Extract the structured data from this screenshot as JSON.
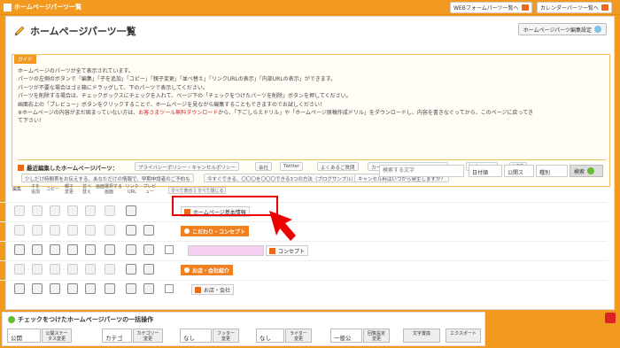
{
  "topbar": {
    "app_title": "ホームページパーツ一覧",
    "btn_web": "WEBフォームパーツ一覧へ",
    "btn_cal": "カレンダーパーツ一覧へ"
  },
  "page": {
    "title": "ホームページパーツ一覧",
    "settings_btn": "ホームページパーツ編集設定"
  },
  "guide": {
    "tag": "ガイド",
    "l1": "ホームページのパーツが全て表示されています。",
    "l2": "パーツの左側のボタンで「編集」「子を追加」「コピー」「親子変更」「並べ替え」「リンクURLの表示」「内部URLの表示」ができます。",
    "l3": "パーツが不要な場合はゴミ箱にドラッグして、下のパーツで表示してください。",
    "l4": "パーツを削除する場合は、チェックボックスにチェックを入れて、ページ下の「チェックをつけたパーツを削除」ボタンを押してください。",
    "l5": "画面右上の「プレビュー」ボタンをクリックすることで、ホームページを見ながら編集することもできますのでお試しください！",
    "l6a": "※ホームページの内容がまだ固まっていない方は、",
    "l6b": "お客さまツール無料ダウンロード",
    "l6c": "から、「下ごしらえドリル」や「ホームページ原稿作成ドリル」をダウンロードし、内容を書きなぐってから、このページに戻ってき",
    "l7": "て下さい！"
  },
  "recent": {
    "label": "最近編集したホームページパーツ：",
    "chips": [
      "プライバシーポリシー・キャンセルポリシー",
      "会社",
      "Twitter",
      "よくあるご質問",
      "カードでの支払いは可能ですか？",
      "Instagram",
      "LINE",
      "少しだけ時間帯をお伝えする、あなただけの情報で、早期申請者のご予約も",
      "今すぐできる、〇〇〇を〇〇〇できる3つの方法（ブログサンプル）",
      "キャンセル料はいつから発生しますか？"
    ]
  },
  "columns": [
    "編集",
    "子を追加",
    "コピー",
    "親子変更",
    "並べ替え",
    "画面選択する画面",
    "リンクURL",
    "プレビュー"
  ],
  "toggles": {
    "open": "すべて表示",
    "close": "すべて閉じる"
  },
  "search": {
    "placeholder": "検索する文字",
    "sort": "日付順",
    "status": "公開ス",
    "type": "種別",
    "button": "検索"
  },
  "rows": [
    {
      "label": "ホームページ基本情報",
      "kind": "part"
    },
    {
      "label": "こだわり・コンセプト",
      "kind": "cat"
    },
    {
      "label": "コンセプト",
      "kind": "part"
    },
    {
      "label": "お店・会社紹介",
      "kind": "cat"
    },
    {
      "label": "お店・会社",
      "kind": "part"
    }
  ],
  "bottom": {
    "title": "チェックをつけたホームページパーツの一括操作",
    "s1": "公開",
    "b1": "公開ステータス変更",
    "s2": "カテゴ",
    "b2": "カテゴリー変更",
    "s3": "なし",
    "b3": "フッター変更",
    "s4": "なし",
    "b4": "ライター変更",
    "s5": "一般公",
    "b5": "回覧設定変更",
    "b6": "文字置換",
    "b7": "エクスポート"
  }
}
